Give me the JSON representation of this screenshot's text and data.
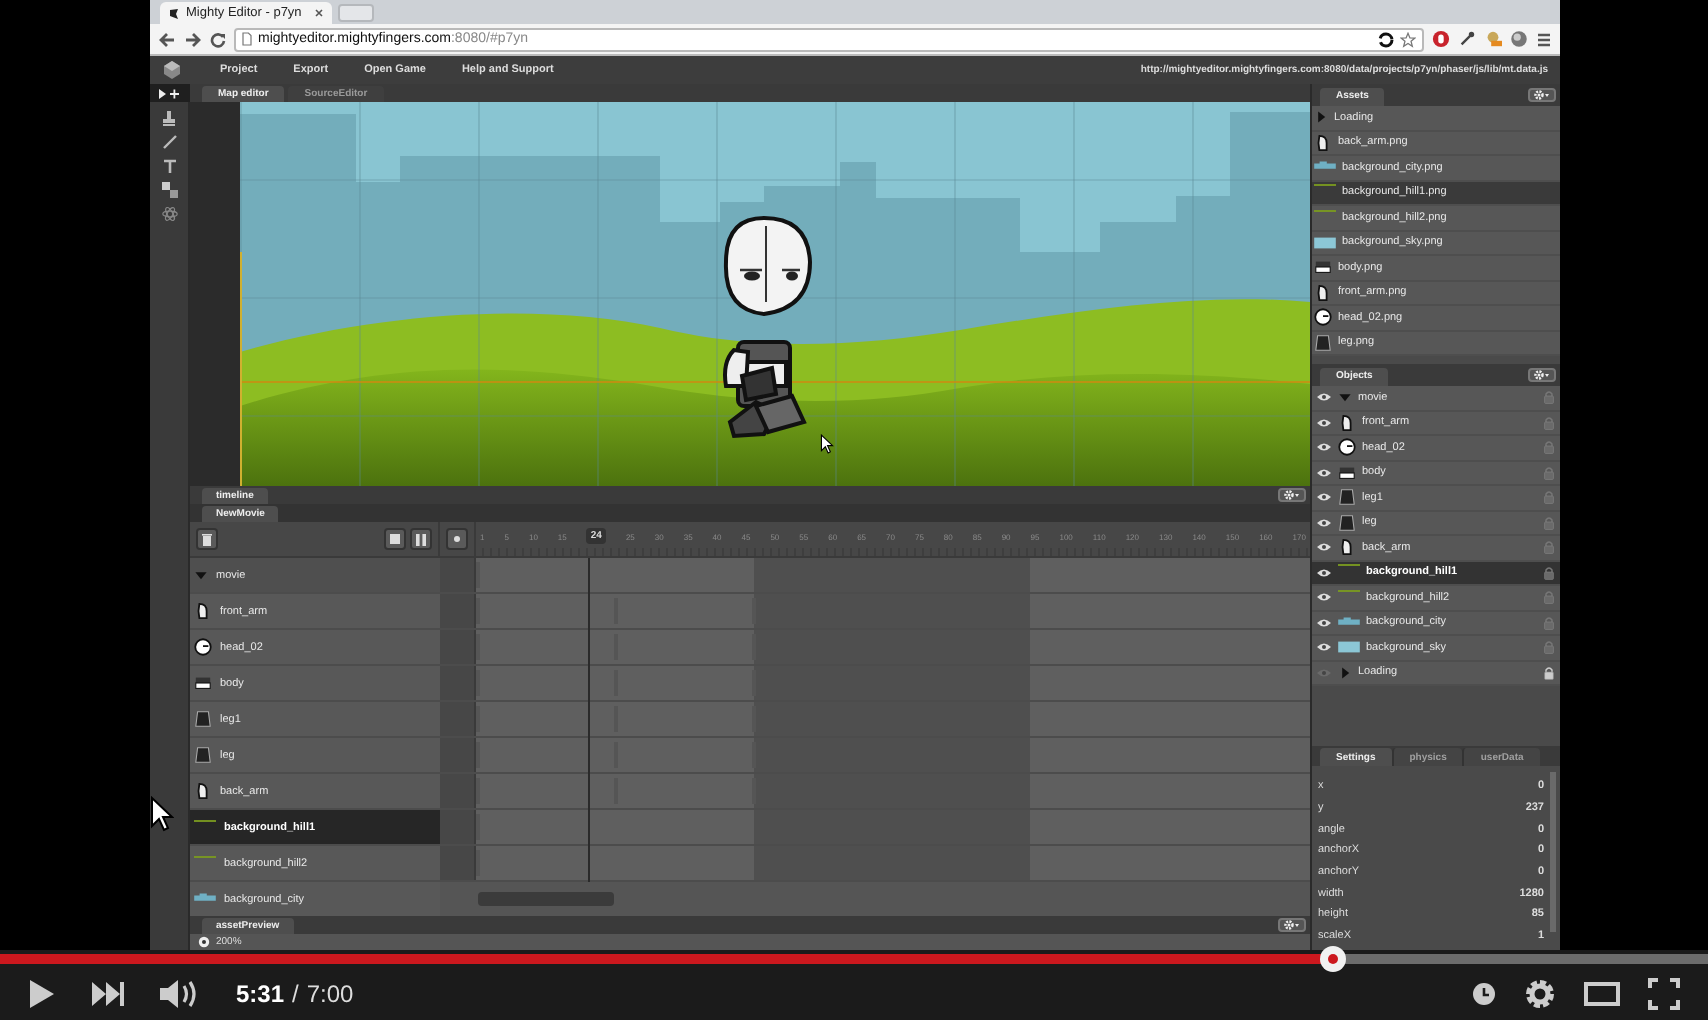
{
  "browser": {
    "tab_title": "Mighty Editor - p7yn",
    "url_host": "mightyeditor.mightyfingers.com",
    "url_path": ":8080/#p7yn"
  },
  "menu": {
    "items": [
      "Project",
      "Export",
      "Open Game",
      "Help and Support"
    ],
    "path": "http://mightyeditor.mightyfingers.com:8080/data/projects/p7yn/phaser/js/lib/mt.data.js"
  },
  "editor_tabs": [
    {
      "label": "Map editor",
      "selected": true
    },
    {
      "label": "SourceEditor",
      "selected": false
    }
  ],
  "assets": {
    "title": "Assets",
    "items": [
      {
        "name": "Loading",
        "kind": "group",
        "expanded": false,
        "selected": false
      },
      {
        "name": "back_arm.png",
        "kind": "arm",
        "selected": false
      },
      {
        "name": "background_city.png",
        "kind": "city",
        "selected": false
      },
      {
        "name": "background_hill1.png",
        "kind": "strip",
        "selected": true
      },
      {
        "name": "background_hill2.png",
        "kind": "strip",
        "selected": false
      },
      {
        "name": "background_sky.png",
        "kind": "sky",
        "selected": false
      },
      {
        "name": "body.png",
        "kind": "body",
        "selected": false
      },
      {
        "name": "front_arm.png",
        "kind": "arm",
        "selected": false
      },
      {
        "name": "head_02.png",
        "kind": "head",
        "selected": false
      },
      {
        "name": "leg.png",
        "kind": "leg",
        "selected": false
      }
    ]
  },
  "objects": {
    "title": "Objects",
    "items": [
      {
        "name": "movie",
        "kind": "group",
        "expanded": true,
        "visible": true,
        "locked": false,
        "selected": false
      },
      {
        "name": "front_arm",
        "kind": "arm",
        "visible": true,
        "locked": false,
        "selected": false
      },
      {
        "name": "head_02",
        "kind": "head",
        "visible": true,
        "locked": false,
        "selected": false
      },
      {
        "name": "body",
        "kind": "body",
        "visible": true,
        "locked": false,
        "selected": false
      },
      {
        "name": "leg1",
        "kind": "leg",
        "visible": true,
        "locked": false,
        "selected": false
      },
      {
        "name": "leg",
        "kind": "leg",
        "visible": true,
        "locked": false,
        "selected": false
      },
      {
        "name": "back_arm",
        "kind": "arm",
        "visible": true,
        "locked": false,
        "selected": false
      },
      {
        "name": "background_hill1",
        "kind": "strip",
        "visible": true,
        "locked": false,
        "selected": true
      },
      {
        "name": "background_hill2",
        "kind": "strip",
        "visible": true,
        "locked": false,
        "selected": false
      },
      {
        "name": "background_city",
        "kind": "city",
        "visible": true,
        "locked": false,
        "selected": false
      },
      {
        "name": "background_sky",
        "kind": "sky",
        "visible": true,
        "locked": false,
        "selected": false
      },
      {
        "name": "Loading",
        "kind": "group",
        "expanded": false,
        "visible": false,
        "locked": true,
        "selected": false
      }
    ]
  },
  "timeline": {
    "title": "timeline",
    "movie_tab": "NewMovie",
    "ruler": [
      {
        "label": "1",
        "kind": "tick"
      },
      {
        "label": "5",
        "kind": "tick"
      },
      {
        "label": "10",
        "kind": "tick"
      },
      {
        "label": "15",
        "kind": "tick"
      },
      {
        "label": "24",
        "kind": "current"
      },
      {
        "label": "25",
        "kind": "tick"
      },
      {
        "label": "30",
        "kind": "tick"
      },
      {
        "label": "35",
        "kind": "tick"
      },
      {
        "label": "40",
        "kind": "tick"
      },
      {
        "label": "45",
        "kind": "tick"
      },
      {
        "label": "50",
        "kind": "tick"
      },
      {
        "label": "55",
        "kind": "tick"
      },
      {
        "label": "60",
        "kind": "tick"
      },
      {
        "label": "65",
        "kind": "tick"
      },
      {
        "label": "70",
        "kind": "tick"
      },
      {
        "label": "75",
        "kind": "tick"
      },
      {
        "label": "80",
        "kind": "tick"
      },
      {
        "label": "85",
        "kind": "tick"
      },
      {
        "label": "90",
        "kind": "tick"
      },
      {
        "label": "95",
        "kind": "tick"
      },
      {
        "label": "100",
        "kind": "tick"
      },
      {
        "label": "110",
        "kind": "tick"
      },
      {
        "label": "120",
        "kind": "tick"
      },
      {
        "label": "130",
        "kind": "tick"
      },
      {
        "label": "140",
        "kind": "tick"
      },
      {
        "label": "150",
        "kind": "tick"
      },
      {
        "label": "160",
        "kind": "tick"
      },
      {
        "label": "170",
        "kind": "tick"
      }
    ],
    "rows": [
      {
        "name": "movie",
        "kind": "group",
        "expanded": true,
        "selected": false
      },
      {
        "name": "front_arm",
        "kind": "arm",
        "selected": false
      },
      {
        "name": "head_02",
        "kind": "head",
        "selected": false
      },
      {
        "name": "body",
        "kind": "body",
        "selected": false
      },
      {
        "name": "leg1",
        "kind": "leg",
        "selected": false
      },
      {
        "name": "leg",
        "kind": "leg",
        "selected": false
      },
      {
        "name": "back_arm",
        "kind": "arm",
        "selected": false
      },
      {
        "name": "background_hill1",
        "kind": "strip",
        "selected": true
      },
      {
        "name": "background_hill2",
        "kind": "strip",
        "selected": false
      },
      {
        "name": "background_city",
        "kind": "city",
        "selected": false
      }
    ]
  },
  "asset_preview": {
    "title": "assetPreview",
    "zoom": "200%"
  },
  "settings": {
    "tabs": [
      {
        "label": "Settings",
        "selected": true
      },
      {
        "label": "physics",
        "selected": false
      },
      {
        "label": "userData",
        "selected": false
      }
    ],
    "properties": [
      {
        "name": "x",
        "value": "0"
      },
      {
        "name": "y",
        "value": "237"
      },
      {
        "name": "angle",
        "value": "0"
      },
      {
        "name": "anchorX",
        "value": "0"
      },
      {
        "name": "anchorY",
        "value": "0"
      },
      {
        "name": "width",
        "value": "1280"
      },
      {
        "name": "height",
        "value": "85"
      },
      {
        "name": "scaleX",
        "value": "1"
      }
    ]
  },
  "player": {
    "current_time": "5:31",
    "separator": "/",
    "total_time": "7:00",
    "level": 0.78
  }
}
